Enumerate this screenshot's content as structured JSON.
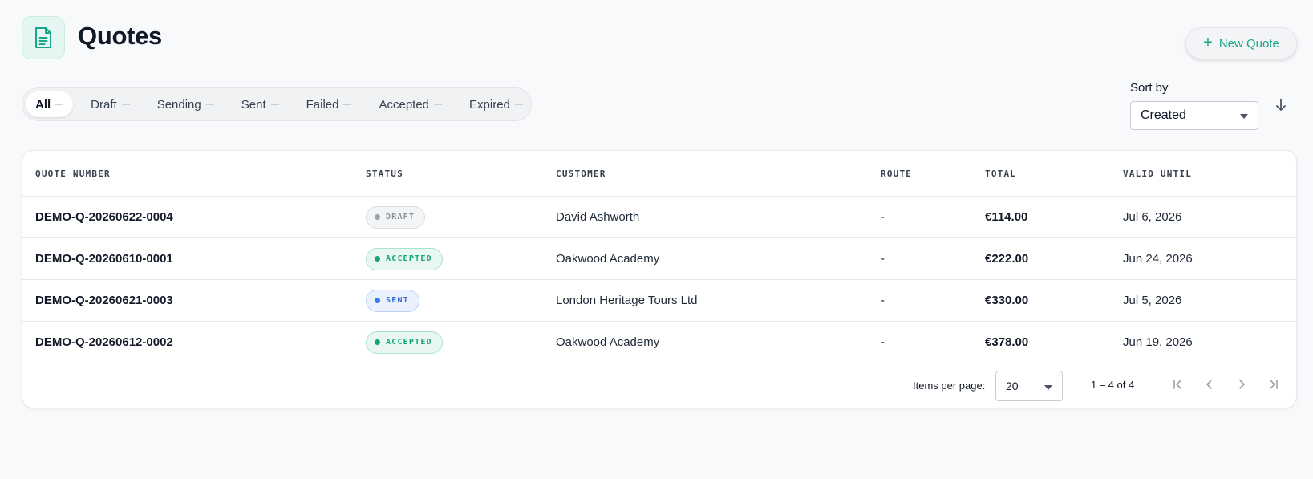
{
  "header": {
    "title": "Quotes",
    "new_button_label": "New Quote"
  },
  "tabs": [
    {
      "label": "All",
      "active": true
    },
    {
      "label": "Draft",
      "active": false
    },
    {
      "label": "Sending",
      "active": false
    },
    {
      "label": "Sent",
      "active": false
    },
    {
      "label": "Failed",
      "active": false
    },
    {
      "label": "Accepted",
      "active": false
    },
    {
      "label": "Expired",
      "active": false
    }
  ],
  "sort": {
    "label": "Sort by",
    "value": "Created",
    "direction": "descending"
  },
  "table": {
    "columns": {
      "quote_number": "QUOTE NUMBER",
      "status": "STATUS",
      "customer": "CUSTOMER",
      "route": "ROUTE",
      "total": "TOTAL",
      "valid_until": "VALID UNTIL"
    },
    "rows": [
      {
        "quote_number": "DEMO-Q-20260622-0004",
        "status": "DRAFT",
        "customer": "David Ashworth",
        "route": "-",
        "total": "€114.00",
        "valid_until": "Jul 6, 2026"
      },
      {
        "quote_number": "DEMO-Q-20260610-0001",
        "status": "ACCEPTED",
        "customer": "Oakwood Academy",
        "route": "-",
        "total": "€222.00",
        "valid_until": "Jun 24, 2026"
      },
      {
        "quote_number": "DEMO-Q-20260621-0003",
        "status": "SENT",
        "customer": "London Heritage Tours Ltd",
        "route": "-",
        "total": "€330.00",
        "valid_until": "Jul 5, 2026"
      },
      {
        "quote_number": "DEMO-Q-20260612-0002",
        "status": "ACCEPTED",
        "customer": "Oakwood Academy",
        "route": "-",
        "total": "€378.00",
        "valid_until": "Jun 19, 2026"
      }
    ]
  },
  "status_colors": {
    "DRAFT": {
      "text": "#8a919c",
      "bg": "#f3f4f6",
      "border": "#d8dbe0",
      "dot": "#9ca3af"
    },
    "ACCEPTED": {
      "text": "#16a37a",
      "bg": "#e8f8f1",
      "border": "#a7e3cc",
      "dot": "#16a37a"
    },
    "SENT": {
      "text": "#3b6fd8",
      "bg": "#eaf1fd",
      "border": "#bcd2f6",
      "dot": "#3b7be8"
    }
  },
  "paginator": {
    "items_per_page_label": "Items per page:",
    "items_per_page": "20",
    "range": "1 – 4 of 4"
  },
  "colors": {
    "accent": "#1aa68a",
    "background": "#f8f9fb"
  }
}
